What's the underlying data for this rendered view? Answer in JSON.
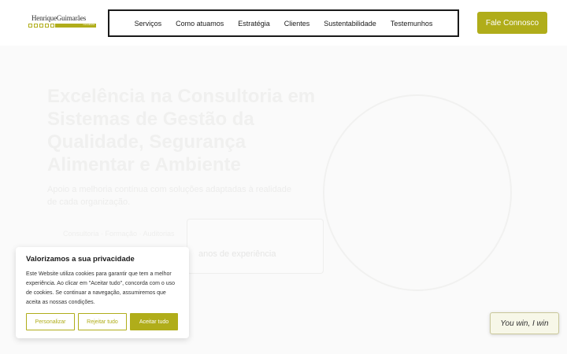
{
  "header": {
    "logo_text": "HenriqueGuimarães",
    "logo_tagline": "consultoria",
    "nav": [
      {
        "label": "Serviços"
      },
      {
        "label": "Como atuamos"
      },
      {
        "label": "Estratégia"
      },
      {
        "label": "Clientes"
      },
      {
        "label": "Sustentabilidade"
      },
      {
        "label": "Testemunhos"
      }
    ],
    "cta_label": "Fale Connosco"
  },
  "hero": {
    "title": "Excelência na Consultoria em Sistemas de Gestão da Qualidade, Segurança Alimentar e Ambiente",
    "subtitle": "Apoio a melhoria contínua com soluções adaptadas à realidade de cada organização.",
    "card_text": "anos de experiência",
    "faded_text": "Consultoria · Formação · Auditorias"
  },
  "cookie": {
    "title": "Valorizamos a sua privacidade",
    "text": "Este Website utiliza cookies para garantir que tem a melhor experiência. Ao clicar em \"Aceitar tudo\", concorda com o uso de cookies. Se continuar a navegação, assumiremos que aceita as nossas condições.",
    "customize_label": "Personalizar",
    "reject_label": "Rejeitar tudo",
    "accept_label": "Aceitar tudo"
  },
  "chat": {
    "label": "You win, I win"
  },
  "colors": {
    "accent": "#b0ad1a",
    "nav_border": "#1a1a1a"
  }
}
